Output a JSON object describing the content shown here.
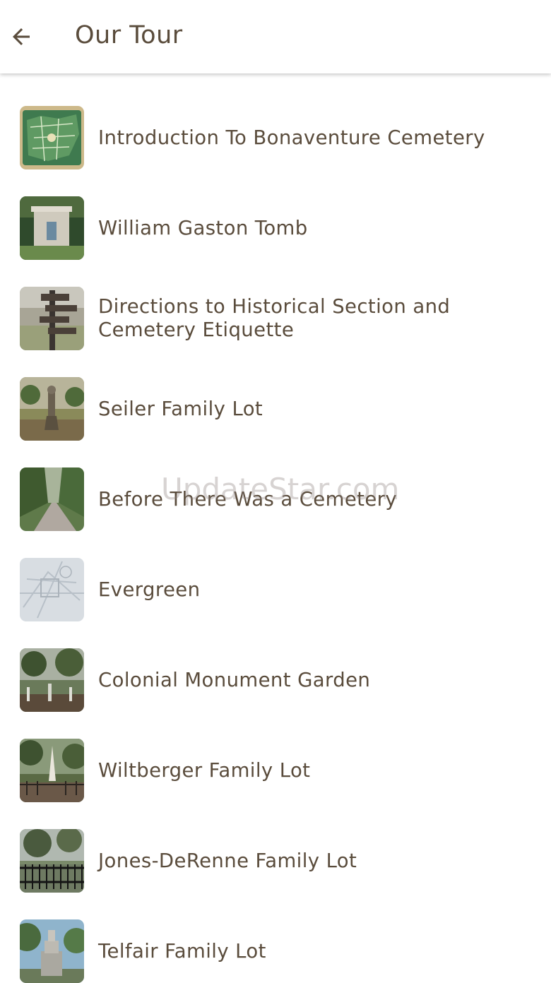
{
  "app_bar": {
    "title": "Our Tour",
    "back_icon": "arrow-left-icon"
  },
  "tour_stops": [
    {
      "label": "Introduction To Bonaventure Cemetery",
      "thumbnail": "cemetery-map-image"
    },
    {
      "label": "William Gaston Tomb",
      "thumbnail": "tomb-photo"
    },
    {
      "label": "Directions to Historical Section and Cemetery Etiquette",
      "thumbnail": "signpost-photo"
    },
    {
      "label": "Seiler Family Lot",
      "thumbnail": "family-lot-photo"
    },
    {
      "label": "Before There Was a Cemetery",
      "thumbnail": "tree-lined-road-photo"
    },
    {
      "label": "Evergreen",
      "thumbnail": "old-map-image"
    },
    {
      "label": "Colonial Monument Garden",
      "thumbnail": "monument-garden-photo"
    },
    {
      "label": "Wiltberger Family Lot",
      "thumbnail": "obelisk-photo"
    },
    {
      "label": "Jones-DeRenne Family Lot",
      "thumbnail": "iron-fence-photo"
    },
    {
      "label": "Telfair Family Lot",
      "thumbnail": "monument-sky-photo"
    }
  ],
  "watermark": "UpdateStar.com",
  "colors": {
    "text": "#5a4c3c",
    "background": "#ffffff"
  }
}
